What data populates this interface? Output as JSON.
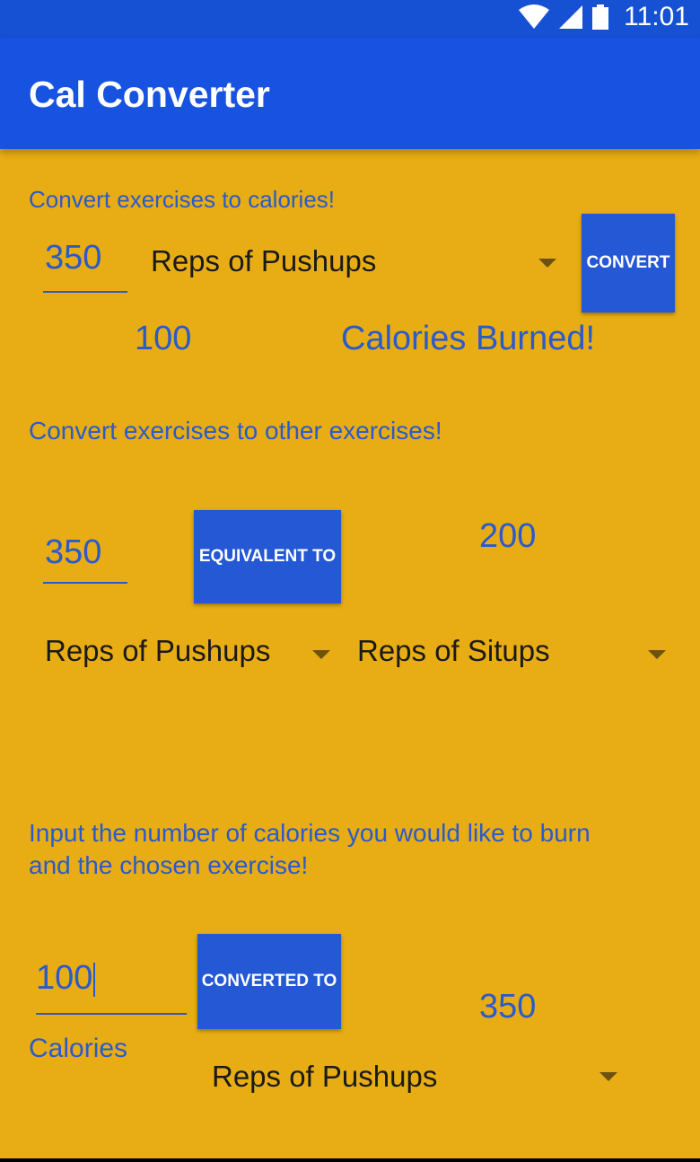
{
  "status_bar": {
    "time": "11:01"
  },
  "app": {
    "title": "Cal Converter"
  },
  "section1": {
    "heading": "Convert exercises to calories!",
    "input_value": "350",
    "exercise": "Reps of Pushups",
    "button_label": "CONVERT",
    "result_value": "100",
    "result_text": "Calories Burned!"
  },
  "section2": {
    "heading": "Convert exercises to other exercises!",
    "input_value": "350",
    "button_label": "EQUIVALENT TO",
    "result_value": "200",
    "from_exercise": "Reps of Pushups",
    "to_exercise": "Reps of Situps"
  },
  "section3": {
    "heading_line1": "Input the number of calories you would like to burn",
    "heading_line2": "and the chosen exercise!",
    "input_value": "100",
    "input_unit": "Calories",
    "button_label": "CONVERTED TO",
    "result_value": "350",
    "exercise": "Reps of Pushups"
  }
}
